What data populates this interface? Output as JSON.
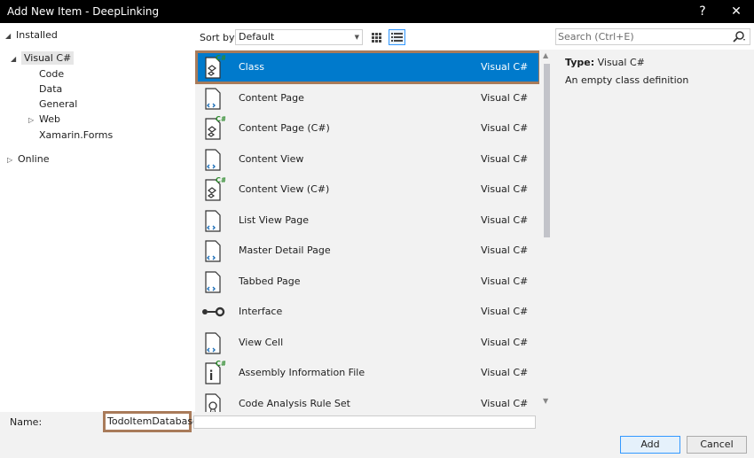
{
  "window": {
    "title": "Add New Item - DeepLinking",
    "help_label": "?",
    "close_label": "✕"
  },
  "tree": {
    "installed": "Installed",
    "visual_csharp": "Visual C#",
    "code": "Code",
    "data": "Data",
    "general": "General",
    "web": "Web",
    "xamarin_forms": "Xamarin.Forms",
    "online": "Online"
  },
  "sort": {
    "label": "Sort by:",
    "value": "Default"
  },
  "search": {
    "placeholder": "Search (Ctrl+E)"
  },
  "templates": [
    {
      "name": "Class",
      "lang": "Visual C#",
      "icon": "class-icon",
      "selected": true
    },
    {
      "name": "Content Page",
      "lang": "Visual C#",
      "icon": "xaml-page-icon"
    },
    {
      "name": "Content Page (C#)",
      "lang": "Visual C#",
      "icon": "csharp-page-icon"
    },
    {
      "name": "Content View",
      "lang": "Visual C#",
      "icon": "xaml-page-icon"
    },
    {
      "name": "Content View (C#)",
      "lang": "Visual C#",
      "icon": "csharp-page-icon"
    },
    {
      "name": "List View Page",
      "lang": "Visual C#",
      "icon": "xaml-page-icon"
    },
    {
      "name": "Master Detail Page",
      "lang": "Visual C#",
      "icon": "xaml-page-icon"
    },
    {
      "name": "Tabbed Page",
      "lang": "Visual C#",
      "icon": "xaml-page-icon"
    },
    {
      "name": "Interface",
      "lang": "Visual C#",
      "icon": "interface-icon"
    },
    {
      "name": "View Cell",
      "lang": "Visual C#",
      "icon": "xaml-page-icon"
    },
    {
      "name": "Assembly Information File",
      "lang": "Visual C#",
      "icon": "assembly-info-icon"
    },
    {
      "name": "Code Analysis Rule Set",
      "lang": "Visual C#",
      "icon": "rule-set-icon"
    }
  ],
  "details": {
    "type_label": "Type:",
    "type_value": "Visual C#",
    "description": "An empty class definition"
  },
  "bottom": {
    "name_label": "Name:",
    "name_value": "TodoItemDatabase",
    "add_label": "Add",
    "cancel_label": "Cancel"
  },
  "colors": {
    "selection": "#007acc",
    "highlight_border": "#a97b5a",
    "csharp_green": "#2e8b2e"
  }
}
